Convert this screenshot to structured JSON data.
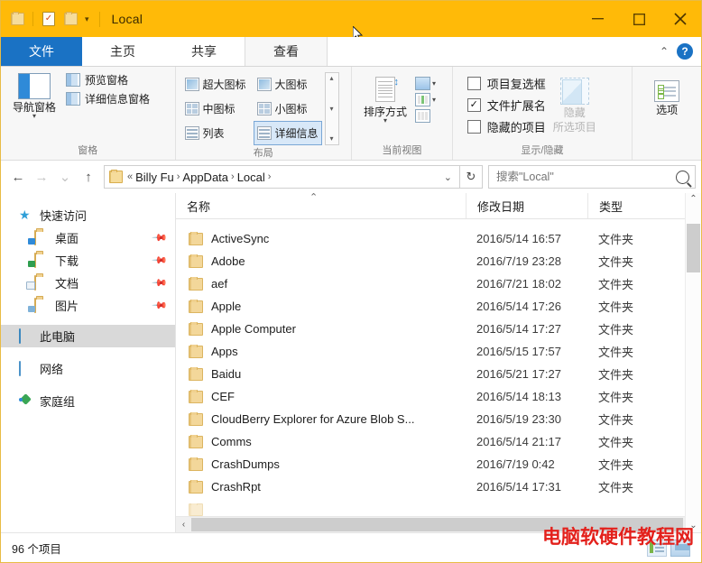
{
  "titlebar": {
    "window_title": "Local",
    "quick_access": [
      {
        "name": "folder-icon",
        "label": ""
      },
      {
        "name": "properties-icon",
        "label": ""
      },
      {
        "name": "new-folder-icon",
        "label": ""
      },
      {
        "name": "customize-dropdown",
        "label": "▾"
      }
    ],
    "controls": {
      "minimize": "–",
      "maximize": "□",
      "close": "✕"
    },
    "accent_color": "#ffba08"
  },
  "tabs": {
    "file": "文件",
    "items": [
      {
        "label": "主页",
        "active": false
      },
      {
        "label": "共享",
        "active": false
      },
      {
        "label": "查看",
        "active": true
      }
    ],
    "collapse": "⌃",
    "help": "?"
  },
  "ribbon": {
    "groups": [
      {
        "title": "窗格",
        "nav_button": "导航窗格",
        "checks": [
          {
            "label": "预览窗格"
          },
          {
            "label": "详细信息窗格"
          }
        ]
      },
      {
        "title": "布局",
        "gallery": [
          {
            "label": "超大图标",
            "selected": false
          },
          {
            "label": "大图标",
            "selected": false
          },
          {
            "label": "中图标",
            "selected": false
          },
          {
            "label": "小图标",
            "selected": false
          },
          {
            "label": "列表",
            "selected": false
          },
          {
            "label": "详细信息",
            "selected": true
          }
        ]
      },
      {
        "title": "当前视图",
        "sort_button": "排序方式"
      },
      {
        "title": "显示/隐藏",
        "checkboxes": [
          {
            "label": "项目复选框",
            "checked": false
          },
          {
            "label": "文件扩展名",
            "checked": true
          },
          {
            "label": "隐藏的项目",
            "checked": false
          }
        ],
        "hide_button_line1": "隐藏",
        "hide_button_line2": "所选项目",
        "hide_button_disabled": true
      },
      {
        "title": "",
        "options_button": "选项"
      }
    ]
  },
  "address": {
    "back": "←",
    "forward": "→",
    "recent": "⌄",
    "up": "↑",
    "crumbs": [
      "Billy Fu",
      "AppData",
      "Local"
    ],
    "crumb_prefix": "«",
    "separator": "›",
    "dropdown": "⌄",
    "refresh": "↻",
    "search_placeholder": "搜索\"Local\""
  },
  "sidebar": {
    "items": [
      {
        "label": "快速访问",
        "icon": "star-icon",
        "level": 0,
        "pinned": false,
        "selected": false
      },
      {
        "label": "桌面",
        "icon": "desktop-folder-icon",
        "level": 1,
        "pinned": true,
        "selected": false
      },
      {
        "label": "下载",
        "icon": "downloads-folder-icon",
        "level": 1,
        "pinned": true,
        "selected": false
      },
      {
        "label": "文档",
        "icon": "documents-folder-icon",
        "level": 1,
        "pinned": true,
        "selected": false
      },
      {
        "label": "图片",
        "icon": "pictures-folder-icon",
        "level": 1,
        "pinned": true,
        "selected": false
      },
      {
        "label": "此电脑",
        "icon": "this-pc-icon",
        "level": 0,
        "pinned": false,
        "selected": true
      },
      {
        "label": "网络",
        "icon": "network-icon",
        "level": 0,
        "pinned": false,
        "selected": false
      },
      {
        "label": "家庭组",
        "icon": "homegroup-icon",
        "level": 0,
        "pinned": false,
        "selected": false
      }
    ]
  },
  "filelist": {
    "columns": [
      "名称",
      "修改日期",
      "类型"
    ],
    "sort_indicator": "⌃",
    "rows": [
      {
        "name": "ActiveSync",
        "date": "2016/5/14 16:57",
        "type": "文件夹"
      },
      {
        "name": "Adobe",
        "date": "2016/7/19 23:28",
        "type": "文件夹"
      },
      {
        "name": "aef",
        "date": "2016/7/21 18:02",
        "type": "文件夹"
      },
      {
        "name": "Apple",
        "date": "2016/5/14 17:26",
        "type": "文件夹"
      },
      {
        "name": "Apple Computer",
        "date": "2016/5/14 17:27",
        "type": "文件夹"
      },
      {
        "name": "Apps",
        "date": "2016/5/15 17:57",
        "type": "文件夹"
      },
      {
        "name": "Baidu",
        "date": "2016/5/21 17:27",
        "type": "文件夹"
      },
      {
        "name": "CEF",
        "date": "2016/5/14 18:13",
        "type": "文件夹"
      },
      {
        "name": "CloudBerry Explorer for Azure Blob S...",
        "date": "2016/5/19 23:30",
        "type": "文件夹"
      },
      {
        "name": "Comms",
        "date": "2016/5/14 21:17",
        "type": "文件夹"
      },
      {
        "name": "CrashDumps",
        "date": "2016/7/19 0:42",
        "type": "文件夹"
      },
      {
        "name": "CrashRpt",
        "date": "2016/5/14 17:31",
        "type": "文件夹"
      }
    ]
  },
  "statusbar": {
    "item_count": "96 个项目",
    "view_details_title": "详细信息",
    "view_thumbs_title": "大图标"
  },
  "watermark": {
    "text": "电脑软硬件教程网",
    "color": "#e3201b"
  }
}
